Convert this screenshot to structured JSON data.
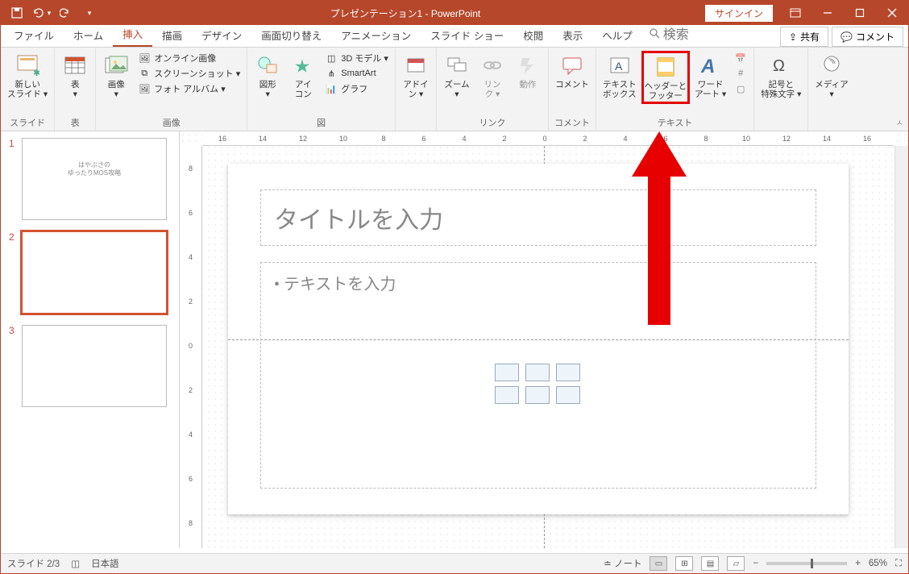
{
  "title": "プレゼンテーション1 - PowerPoint",
  "signin": "サインイン",
  "tabs": {
    "file": "ファイル",
    "home": "ホーム",
    "insert": "挿入",
    "draw": "描画",
    "design": "デザイン",
    "transitions": "画面切り替え",
    "animations": "アニメーション",
    "slideshow": "スライド ショー",
    "review": "校閲",
    "view": "表示",
    "help": "ヘルプ",
    "search": "検索",
    "share": "共有",
    "comment": "コメント"
  },
  "ribbon": {
    "slides": {
      "newSlide": "新しい\nスライド ▾",
      "group": "スライド"
    },
    "tables": {
      "table": "表\n▾",
      "group": "表"
    },
    "images": {
      "pictures": "画像\n▾",
      "online": "オンライン画像",
      "screenshot": "スクリーンショット ▾",
      "album": "フォト アルバム ▾",
      "group": "画像"
    },
    "illust": {
      "shapes": "図形\n▾",
      "icons": "アイ\nコン",
      "model3d": "3D モデル ▾",
      "smartart": "SmartArt",
      "chart": "グラフ",
      "group": "図"
    },
    "addins": {
      "addin": "アドイ\nン ▾"
    },
    "links": {
      "zoom": "ズーム\n▾",
      "link": "リン\nク ▾",
      "action": "動作",
      "group": "リンク"
    },
    "comments": {
      "comment": "コメント",
      "group": "コメント"
    },
    "text": {
      "textbox": "テキスト\nボックス",
      "headerFooter": "ヘッダーと\nフッター",
      "wordart": "ワード\nアート ▾",
      "group": "テキスト"
    },
    "symbols": {
      "symbol": "記号と\n特殊文字 ▾"
    },
    "media": {
      "media": "メディア\n▾"
    }
  },
  "slide": {
    "thumb1_line1": "はやぶさの",
    "thumb1_line2": "ゆったりMOS攻略",
    "titlePlaceholder": "タイトルを入力",
    "bodyPlaceholder": "テキストを入力"
  },
  "ruler_marks": [
    "16",
    "14",
    "12",
    "10",
    "8",
    "6",
    "4",
    "2",
    "0",
    "2",
    "4",
    "6",
    "8",
    "10",
    "12",
    "14",
    "16"
  ],
  "ruler_v_marks": [
    "8",
    "6",
    "4",
    "2",
    "0",
    "2",
    "4",
    "6",
    "8"
  ],
  "status": {
    "slide": "スライド 2/3",
    "lang": "日本語",
    "notes": "ノート",
    "zoom": "65%"
  }
}
